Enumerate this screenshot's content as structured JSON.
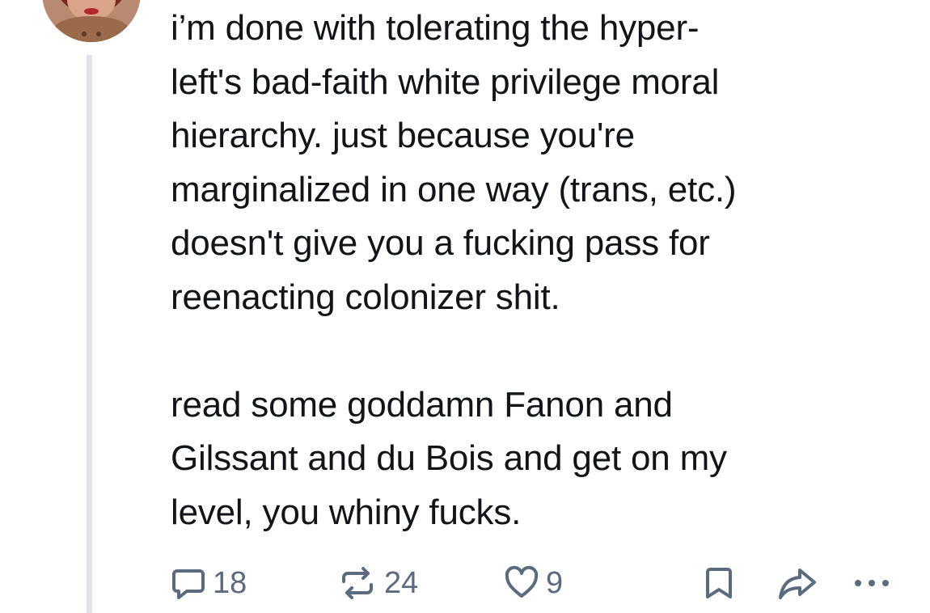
{
  "post": {
    "text": "i’m done with tolerating the hyper-\nleft's bad-faith white privilege moral\nhierarchy. just because you're\nmarginalized in one way (trans, etc.)\ndoesn't give you a fucking pass for\nreenacting colonizer shit.\n\nread some goddamn Fanon and\nGilssant and du Bois and get on my\nlevel, you whiny fucks."
  },
  "actions": {
    "reply_count": "18",
    "repost_count": "24",
    "like_count": "9"
  },
  "icons": {
    "reply": "speech-bubble-icon",
    "repost": "repost-arrows-icon",
    "like": "heart-icon",
    "bookmark": "bookmark-icon",
    "share": "share-arrow-icon",
    "more": "ellipsis-icon"
  },
  "colors": {
    "text": "#111418",
    "icon": "#5b6b7f",
    "thread_line": "#dfe3ea"
  }
}
